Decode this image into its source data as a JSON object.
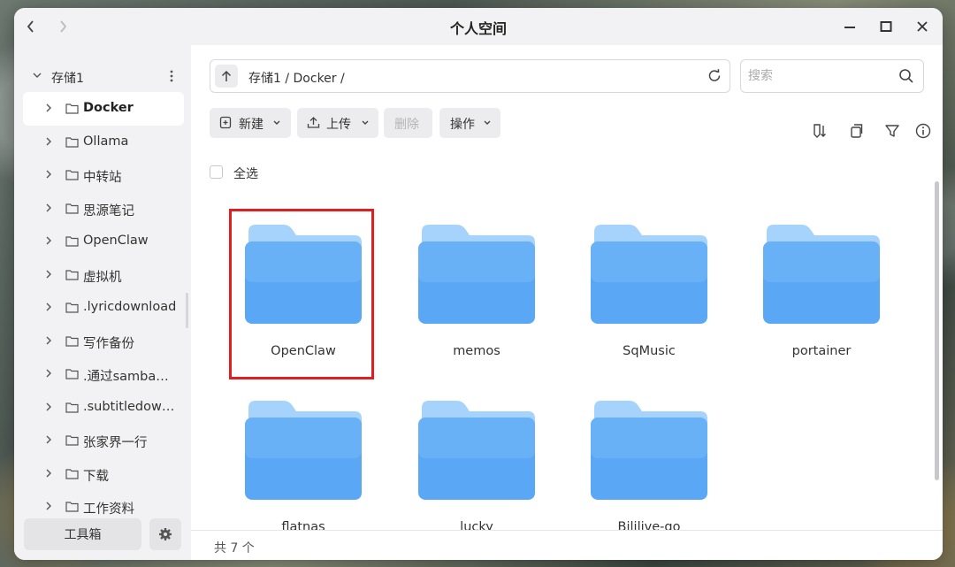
{
  "window": {
    "title": "个人空间"
  },
  "sidebar": {
    "root_label": "存储1",
    "items": [
      {
        "label": "Docker",
        "active": true
      },
      {
        "label": "Ollama"
      },
      {
        "label": "中转站"
      },
      {
        "label": "思源笔记"
      },
      {
        "label": "OpenClaw"
      },
      {
        "label": "虚拟机"
      },
      {
        "label": ".lyricdownload"
      },
      {
        "label": "写作备份"
      },
      {
        "label": ".通过samba…"
      },
      {
        "label": ".subtitledow…"
      },
      {
        "label": "张家界一行"
      },
      {
        "label": "下载"
      },
      {
        "label": "工作资料"
      }
    ],
    "toolbox_label": "工具箱"
  },
  "pathbar": {
    "path": "存储1 / Docker /"
  },
  "search": {
    "placeholder": "搜索"
  },
  "toolbar": {
    "new_label": "新建",
    "upload_label": "上传",
    "delete_label": "删除",
    "actions_label": "操作"
  },
  "select_all_label": "全选",
  "files": [
    {
      "name": "OpenClaw",
      "selected": true
    },
    {
      "name": "memos"
    },
    {
      "name": "SqMusic"
    },
    {
      "name": "portainer"
    },
    {
      "name": "flatnas"
    },
    {
      "name": "lucky"
    },
    {
      "name": "Bililive-go"
    }
  ],
  "status": {
    "count_text": "共 7 个"
  },
  "colors": {
    "folder_front": "#5aa8f5",
    "folder_back": "#a6d3fb",
    "highlight": "#e02020"
  }
}
